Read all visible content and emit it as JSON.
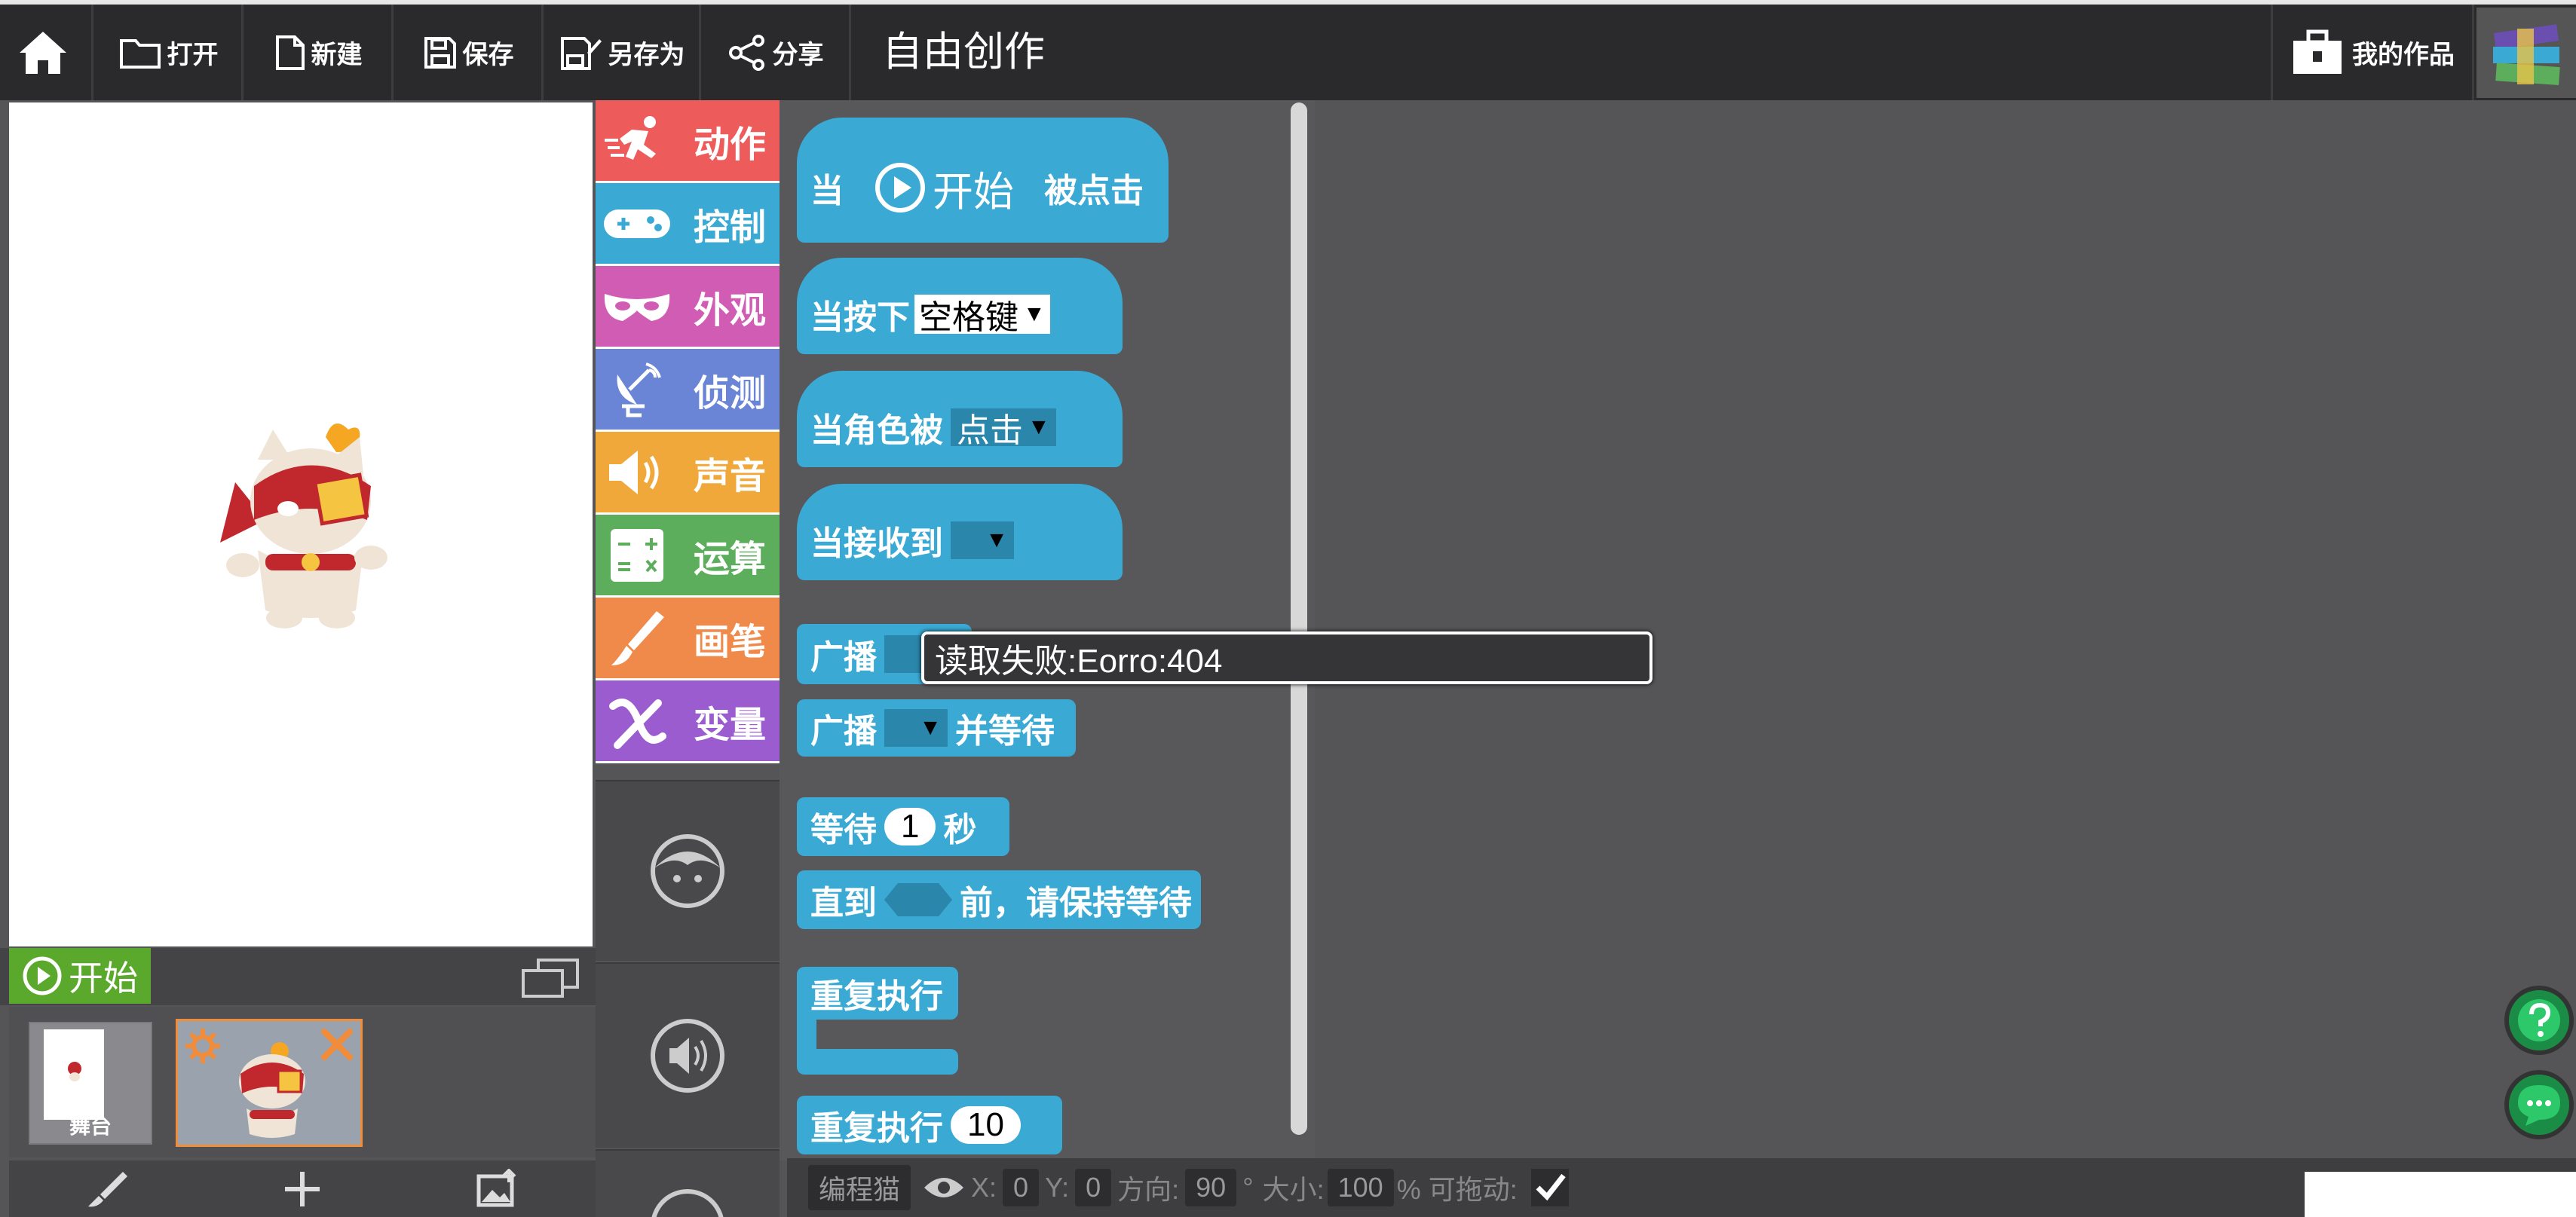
{
  "toolbar": {
    "open": "打开",
    "new": "新建",
    "save": "保存",
    "save_as": "另存为",
    "share": "分享",
    "title": "自由创作",
    "my_works": "我的作品"
  },
  "stage": {
    "start_label": "开始",
    "stage_thumb_label": "舞台"
  },
  "categories": [
    {
      "label": "动作",
      "color": "#ee5b5b",
      "icon": "runner-icon"
    },
    {
      "label": "控制",
      "color": "#3aa9d3",
      "icon": "gamepad-icon"
    },
    {
      "label": "外观",
      "color": "#d15cb3",
      "icon": "mask-icon"
    },
    {
      "label": "侦测",
      "color": "#6a84d6",
      "icon": "radar-icon"
    },
    {
      "label": "声音",
      "color": "#f0a83a",
      "icon": "speaker-icon"
    },
    {
      "label": "运算",
      "color": "#5cae5c",
      "icon": "calculator-icon"
    },
    {
      "label": "画笔",
      "color": "#f08a4b",
      "icon": "brush-icon"
    },
    {
      "label": "变量",
      "color": "#9a5ccf",
      "icon": "variable-x-icon"
    }
  ],
  "blocks": {
    "when_clicked_prefix": "当",
    "when_clicked_start": "开始",
    "when_clicked_suffix": "被点击",
    "when_key_prefix": "当按下",
    "when_key_value": "空格键",
    "when_sprite_prefix": "当角色被",
    "when_sprite_value": "点击",
    "when_receive": "当接收到",
    "broadcast": "广播",
    "broadcast_wait": "广播",
    "broadcast_wait_suffix": "并等待",
    "wait_prefix": "等待",
    "wait_value": "1",
    "wait_suffix": "秒",
    "until_prefix": "直到",
    "until_suffix": "前，请保持等待",
    "repeat_forever": "重复执行",
    "repeat_n_prefix": "重复执行",
    "repeat_n_value": "10"
  },
  "tooltip": "读取失败:Eorro:404",
  "info": {
    "sprite_name": "编程猫",
    "x_label": "X:",
    "x_value": "0",
    "y_label": "Y:",
    "y_value": "0",
    "dir_label": "方向:",
    "dir_value": "90",
    "degree": "°",
    "size_label": "大小:",
    "size_value": "100",
    "percent_drag": "% 可拖动:"
  }
}
